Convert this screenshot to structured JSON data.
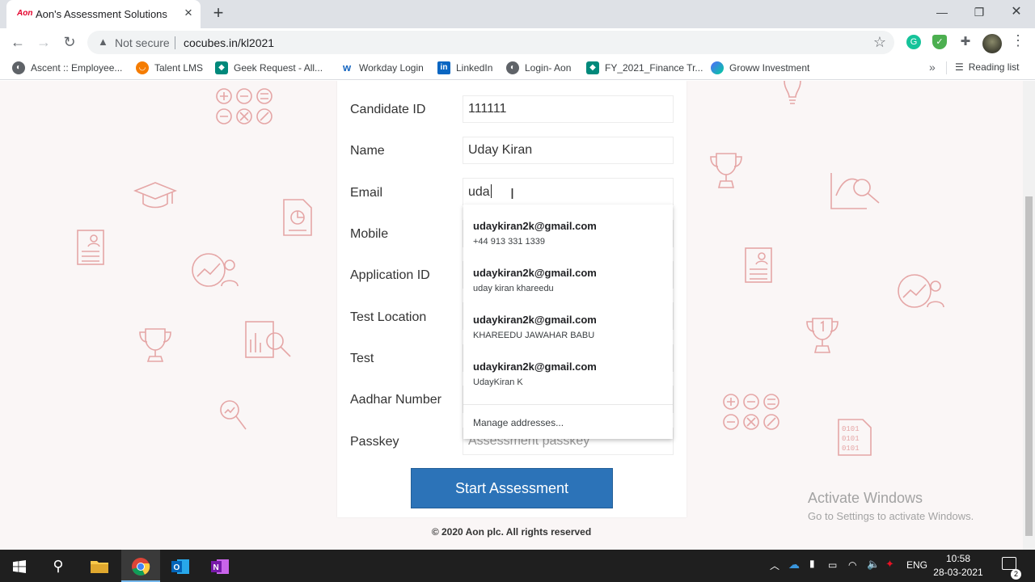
{
  "browser": {
    "tab_title": "Aon's Assessment Solutions",
    "tab_favicon": "Aon",
    "not_secure": "Not secure",
    "url": "cocubes.in/kl2021",
    "bookmarks": [
      {
        "label": "Ascent :: Employee...",
        "icon": "globe-icon",
        "color": "#5f6368"
      },
      {
        "label": "Talent LMS",
        "icon": "talentlms-icon",
        "color": "#f57c00"
      },
      {
        "label": "Geek Request - All...",
        "icon": "geek-icon",
        "color": "#00897b"
      },
      {
        "label": "Workday Login",
        "icon": "workday-icon",
        "color": "#1565c0"
      },
      {
        "label": "LinkedIn",
        "icon": "linkedin-icon",
        "color": "#0a66c2"
      },
      {
        "label": "Login- Aon",
        "icon": "globe-icon",
        "color": "#5f6368"
      },
      {
        "label": "FY_2021_Finance Tr...",
        "icon": "finance-icon",
        "color": "#00897b"
      },
      {
        "label": "Groww Investment",
        "icon": "groww-icon",
        "color": "#5367ff"
      }
    ],
    "reading_list": "Reading list"
  },
  "form": {
    "fields": [
      {
        "label": "Candidate ID",
        "value": "111111"
      },
      {
        "label": "Name",
        "value": "Uday Kiran"
      },
      {
        "label": "Email",
        "value": "uda"
      },
      {
        "label": "Mobile",
        "value": ""
      },
      {
        "label": "Application ID",
        "value": ""
      },
      {
        "label": "Test Location",
        "value": ""
      },
      {
        "label": "Test",
        "value": ""
      },
      {
        "label": "Aadhar Number",
        "value": ""
      },
      {
        "label": "Passkey",
        "placeholder": "Assessment passkey"
      }
    ],
    "submit_label": "Start Assessment"
  },
  "autocomplete": {
    "items": [
      {
        "email": "udaykiran2k@gmail.com",
        "sub": "+44 913 331 1339"
      },
      {
        "email": "udaykiran2k@gmail.com",
        "sub": "uday kiran khareedu"
      },
      {
        "email": "udaykiran2k@gmail.com",
        "sub": "KHAREEDU JAWAHAR BABU"
      },
      {
        "email": "udaykiran2k@gmail.com",
        "sub": "UdayKiran K"
      }
    ],
    "manage": "Manage addresses..."
  },
  "footer": {
    "copyright": "© 2020 Aon plc. All rights reserved"
  },
  "watermark": {
    "line1": "Activate Windows",
    "line2": "Go to Settings to activate Windows."
  },
  "taskbar": {
    "lang": "ENG",
    "time": "10:58",
    "date": "28-03-2021",
    "notif_count": "2"
  },
  "colors": {
    "brand_button": "#2c73b8",
    "deco": "#e5a6a6",
    "page_bg": "#faf6f6"
  }
}
